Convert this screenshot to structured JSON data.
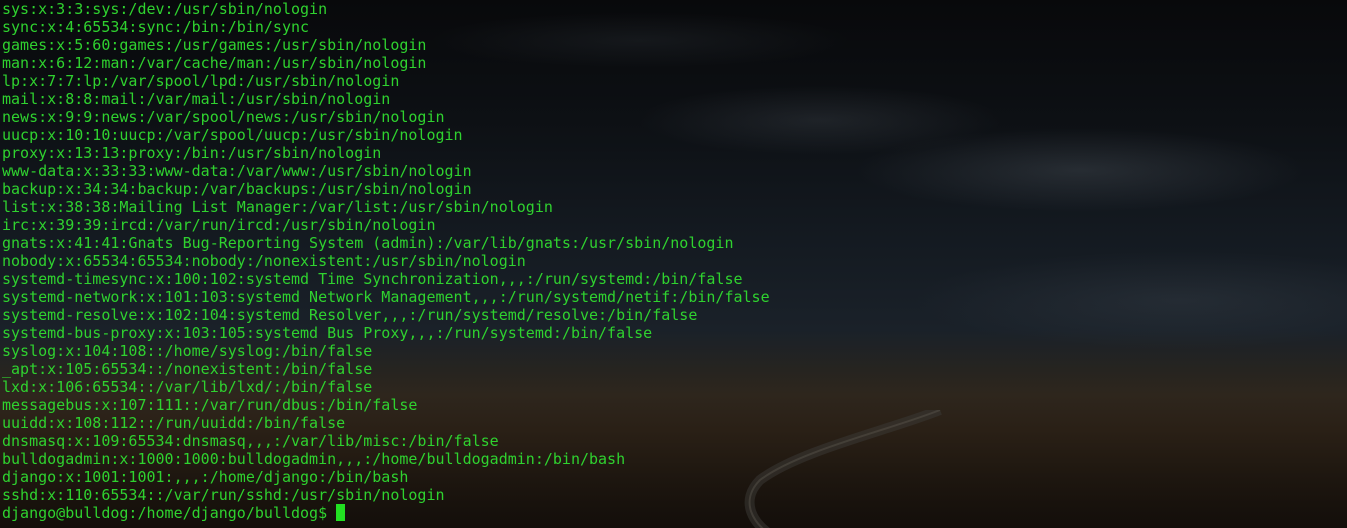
{
  "terminal": {
    "colors": {
      "text": "#2fd22f",
      "cursor": "#22e022",
      "background": "#0b0d10"
    },
    "lines": [
      "sys:x:3:3:sys:/dev:/usr/sbin/nologin",
      "sync:x:4:65534:sync:/bin:/bin/sync",
      "games:x:5:60:games:/usr/games:/usr/sbin/nologin",
      "man:x:6:12:man:/var/cache/man:/usr/sbin/nologin",
      "lp:x:7:7:lp:/var/spool/lpd:/usr/sbin/nologin",
      "mail:x:8:8:mail:/var/mail:/usr/sbin/nologin",
      "news:x:9:9:news:/var/spool/news:/usr/sbin/nologin",
      "uucp:x:10:10:uucp:/var/spool/uucp:/usr/sbin/nologin",
      "proxy:x:13:13:proxy:/bin:/usr/sbin/nologin",
      "www-data:x:33:33:www-data:/var/www:/usr/sbin/nologin",
      "backup:x:34:34:backup:/var/backups:/usr/sbin/nologin",
      "list:x:38:38:Mailing List Manager:/var/list:/usr/sbin/nologin",
      "irc:x:39:39:ircd:/var/run/ircd:/usr/sbin/nologin",
      "gnats:x:41:41:Gnats Bug-Reporting System (admin):/var/lib/gnats:/usr/sbin/nologin",
      "nobody:x:65534:65534:nobody:/nonexistent:/usr/sbin/nologin",
      "systemd-timesync:x:100:102:systemd Time Synchronization,,,:/run/systemd:/bin/false",
      "systemd-network:x:101:103:systemd Network Management,,,:/run/systemd/netif:/bin/false",
      "systemd-resolve:x:102:104:systemd Resolver,,,:/run/systemd/resolve:/bin/false",
      "systemd-bus-proxy:x:103:105:systemd Bus Proxy,,,:/run/systemd:/bin/false",
      "syslog:x:104:108::/home/syslog:/bin/false",
      "_apt:x:105:65534::/nonexistent:/bin/false",
      "lxd:x:106:65534::/var/lib/lxd/:/bin/false",
      "messagebus:x:107:111::/var/run/dbus:/bin/false",
      "uuidd:x:108:112::/run/uuidd:/bin/false",
      "dnsmasq:x:109:65534:dnsmasq,,,:/var/lib/misc:/bin/false",
      "bulldogadmin:x:1000:1000:bulldogadmin,,,:/home/bulldogadmin:/bin/bash",
      "django:x:1001:1001:,,,:/home/django:/bin/bash",
      "sshd:x:110:65534::/var/run/sshd:/usr/sbin/nologin"
    ],
    "prompt": "django@bulldog:/home/django/bulldog$"
  }
}
